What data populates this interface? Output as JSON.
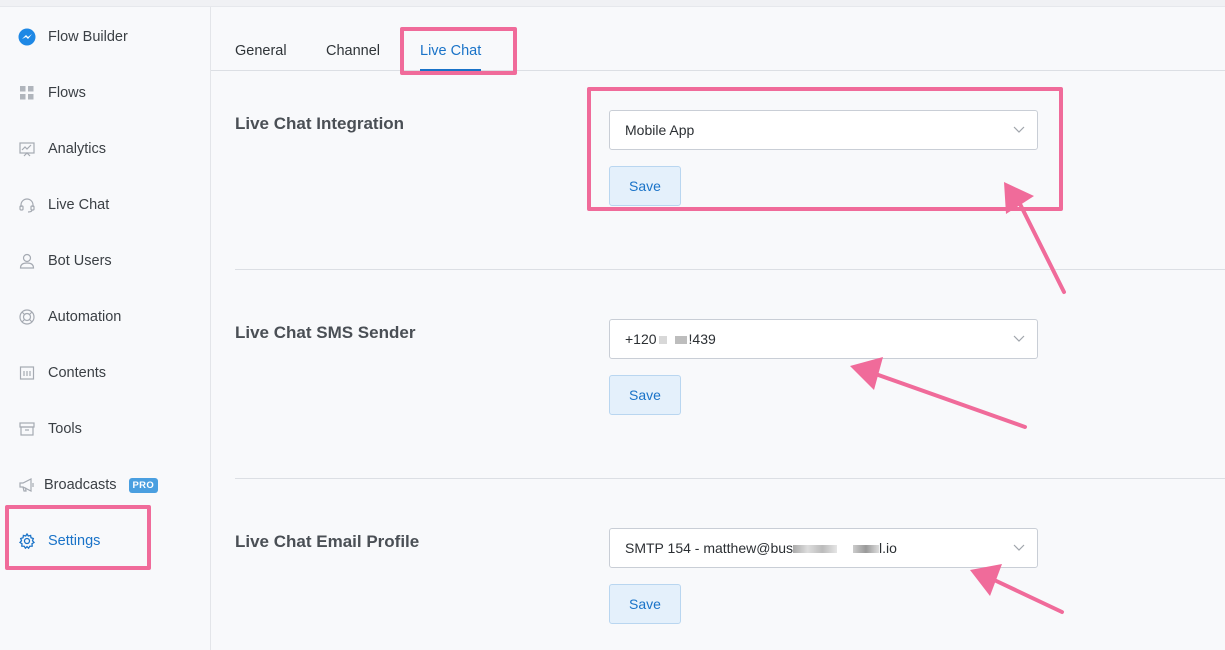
{
  "sidebar": {
    "items": [
      {
        "label": "Flow Builder",
        "icon": "messenger-icon"
      },
      {
        "label": "Flows",
        "icon": "grid-icon"
      },
      {
        "label": "Analytics",
        "icon": "chart-icon"
      },
      {
        "label": "Live Chat",
        "icon": "headset-icon"
      },
      {
        "label": "Bot Users",
        "icon": "user-icon"
      },
      {
        "label": "Automation",
        "icon": "lifebuoy-icon"
      },
      {
        "label": "Contents",
        "icon": "calendar-icon"
      },
      {
        "label": "Tools",
        "icon": "archive-icon"
      },
      {
        "label": "Broadcasts",
        "icon": "megaphone-icon",
        "badge": "PRO"
      },
      {
        "label": "Settings",
        "icon": "gear-icon",
        "active": true
      }
    ]
  },
  "tabs": [
    {
      "label": "General"
    },
    {
      "label": "Channel"
    },
    {
      "label": "Live Chat",
      "active": true
    }
  ],
  "sections": {
    "integration": {
      "title": "Live Chat Integration",
      "value": "Mobile App",
      "save_label": "Save"
    },
    "sms": {
      "title": "Live Chat SMS Sender",
      "value_prefix": "+120",
      "value_suffix": "!439",
      "save_label": "Save"
    },
    "email": {
      "title": "Live Chat Email Profile",
      "value_prefix": "SMTP 154 - matthew@bus",
      "value_suffix": "l.io",
      "save_label": "Save"
    }
  },
  "colors": {
    "accent": "#1a73c8",
    "highlight": "#f06b9a",
    "badge": "#4a9fe0"
  }
}
